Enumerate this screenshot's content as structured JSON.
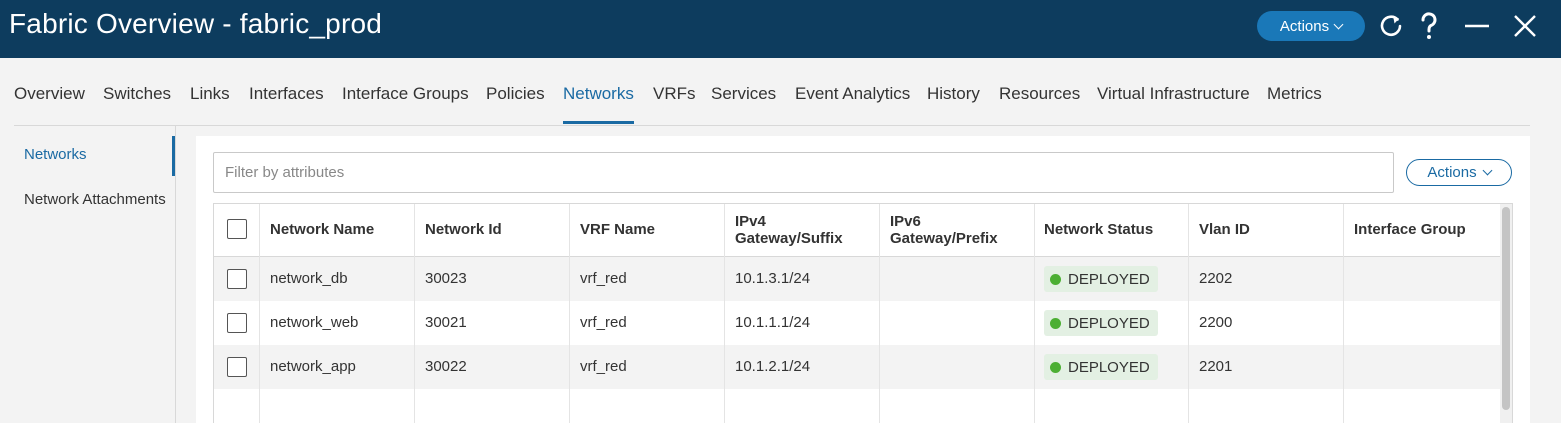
{
  "header": {
    "title": "Fabric Overview - fabric_prod",
    "actions_label": "Actions",
    "icons": [
      "refresh-icon",
      "help-icon",
      "minimize-icon",
      "close-icon"
    ]
  },
  "tabs": [
    {
      "label": "Overview"
    },
    {
      "label": "Switches"
    },
    {
      "label": "Links"
    },
    {
      "label": "Interfaces"
    },
    {
      "label": "Interface Groups"
    },
    {
      "label": "Policies"
    },
    {
      "label": "Networks",
      "active": true
    },
    {
      "label": "VRFs"
    },
    {
      "label": "Services"
    },
    {
      "label": "Event Analytics"
    },
    {
      "label": "History"
    },
    {
      "label": "Resources"
    },
    {
      "label": "Virtual Infrastructure"
    },
    {
      "label": "Metrics"
    }
  ],
  "side_nav": {
    "items": [
      {
        "label": "Networks",
        "active": true
      },
      {
        "label": "Network Attachments"
      }
    ]
  },
  "toolbar": {
    "filter_placeholder": "Filter by attributes",
    "filter_value": "",
    "actions_label": "Actions"
  },
  "table": {
    "columns": [
      {
        "line1": "Network Name",
        "line2": ""
      },
      {
        "line1": "Network Id",
        "line2": ""
      },
      {
        "line1": "VRF Name",
        "line2": ""
      },
      {
        "line1": "IPv4",
        "line2": "Gateway/Suffix"
      },
      {
        "line1": "IPv6",
        "line2": "Gateway/Prefix"
      },
      {
        "line1": "Network Status",
        "line2": ""
      },
      {
        "line1": "Vlan ID",
        "line2": ""
      },
      {
        "line1": "Interface Group",
        "line2": ""
      }
    ],
    "rows": [
      {
        "network_name": "network_db",
        "network_id": "30023",
        "vrf_name": "vrf_red",
        "ipv4": "10.1.3.1/24",
        "ipv6": "",
        "status": "DEPLOYED",
        "vlan_id": "2202",
        "interface_group": ""
      },
      {
        "network_name": "network_web",
        "network_id": "30021",
        "vrf_name": "vrf_red",
        "ipv4": "10.1.1.1/24",
        "ipv6": "",
        "status": "DEPLOYED",
        "vlan_id": "2200",
        "interface_group": ""
      },
      {
        "network_name": "network_app",
        "network_id": "30022",
        "vrf_name": "vrf_red",
        "ipv4": "10.1.2.1/24",
        "ipv6": "",
        "status": "DEPLOYED",
        "vlan_id": "2201",
        "interface_group": ""
      }
    ]
  },
  "colors": {
    "header_bg": "#0d3c5e",
    "accent": "#1a6aa3",
    "status_deployed": "#4caf33"
  }
}
